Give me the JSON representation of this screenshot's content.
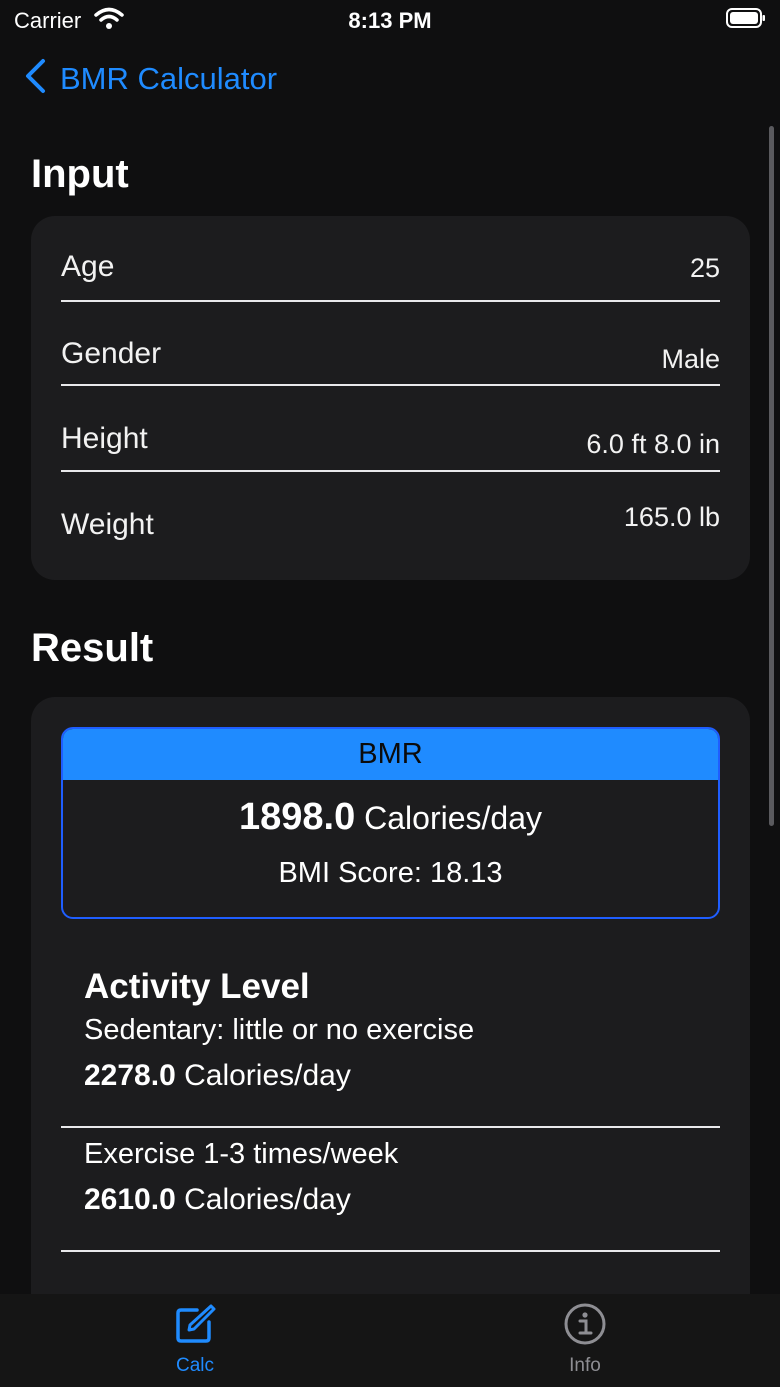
{
  "status_bar": {
    "carrier": "Carrier",
    "time": "8:13 PM"
  },
  "nav": {
    "back_label": "BMR Calculator"
  },
  "input": {
    "title": "Input",
    "rows": [
      {
        "label": "Age",
        "value": "25"
      },
      {
        "label": "Gender",
        "value": "Male"
      },
      {
        "label": "Height",
        "value": "6.0 ft 8.0 in"
      },
      {
        "label": "Weight",
        "value": "165.0 lb"
      }
    ]
  },
  "result": {
    "title": "Result",
    "bmr_header": "BMR",
    "bmr_value": "1898.0",
    "bmr_unit": "Calories/day",
    "bmi_label": "BMI Score: 18.13",
    "activity_title": "Activity Level",
    "activity": [
      {
        "label": "Sedentary: little or no exercise",
        "value": "2278.0",
        "unit": "Calories/day"
      },
      {
        "label": "Exercise 1-3 times/week",
        "value": "2610.0",
        "unit": "Calories/day"
      }
    ]
  },
  "tabs": [
    {
      "label": "Calc",
      "icon": "compose-icon",
      "active": true
    },
    {
      "label": "Info",
      "icon": "info-icon",
      "active": false
    }
  ],
  "colors": {
    "accent": "#1f8bff",
    "background": "#0f0f10",
    "card": "#1c1c1e",
    "inactive": "#8e8e93"
  }
}
